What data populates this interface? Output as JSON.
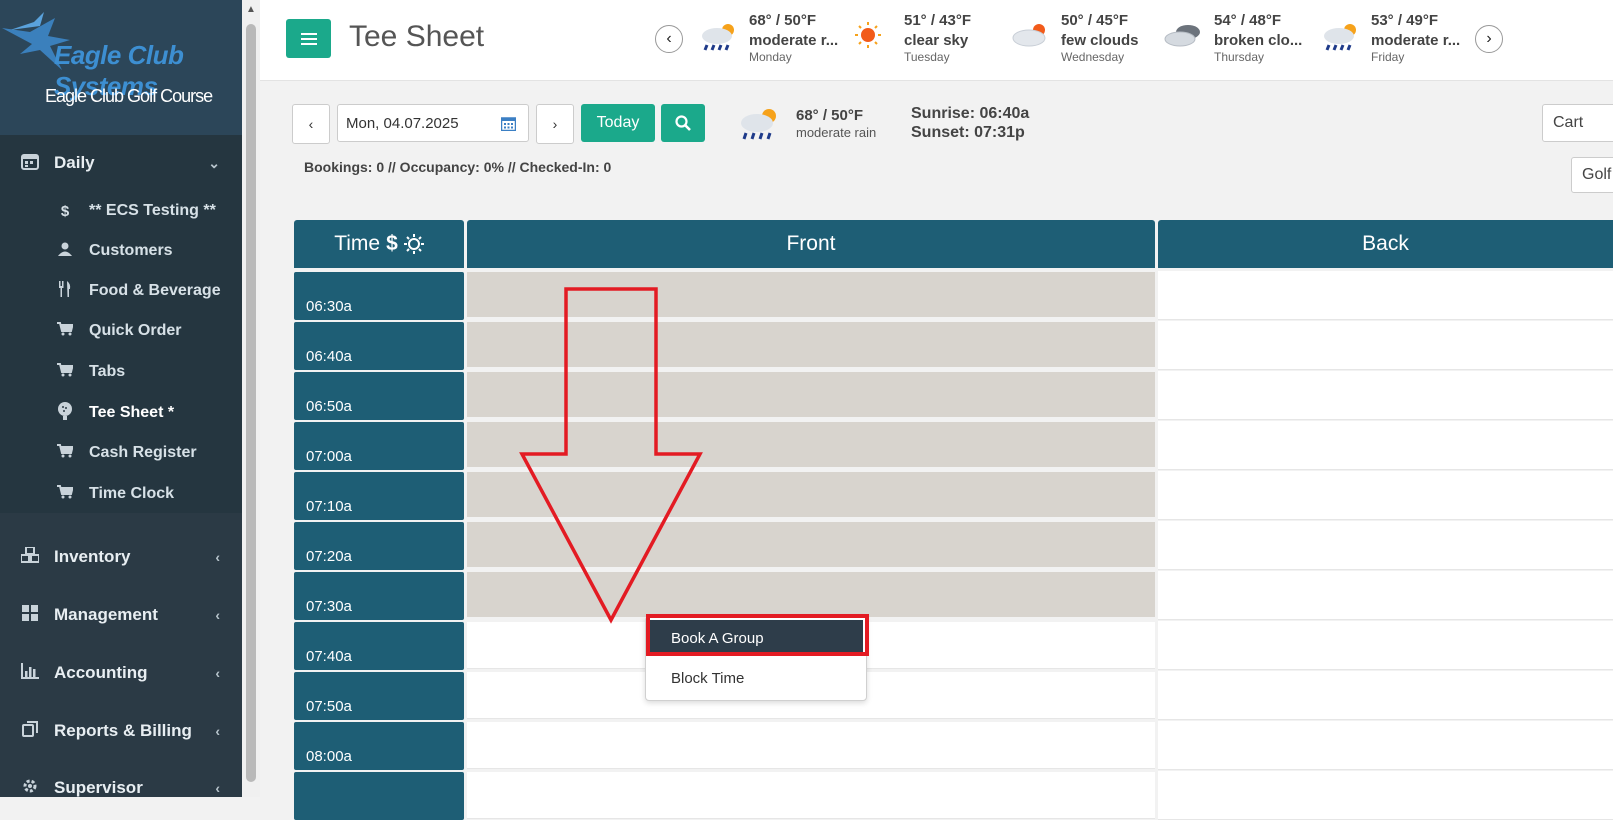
{
  "brand": {
    "name": "Eagle Club Systems",
    "course": "Eagle Club Golf Course"
  },
  "sidebar": {
    "sections": [
      {
        "label": "Daily",
        "icon": "calendar-icon"
      },
      {
        "label": "Inventory",
        "icon": "cubes-icon"
      },
      {
        "label": "Management",
        "icon": "grid-icon"
      },
      {
        "label": "Accounting",
        "icon": "bar-chart-icon"
      },
      {
        "label": "Reports & Billing",
        "icon": "copy-icon"
      },
      {
        "label": "Supervisor",
        "icon": "gear-icon"
      }
    ],
    "daily_items": [
      {
        "label": "** ECS Testing **",
        "icon": "dollar-icon"
      },
      {
        "label": "Customers",
        "icon": "user-icon"
      },
      {
        "label": "Food & Beverage",
        "icon": "utensils-icon"
      },
      {
        "label": "Quick Order",
        "icon": "cart-icon"
      },
      {
        "label": "Tabs",
        "icon": "cart-icon"
      },
      {
        "label": "Tee Sheet *",
        "icon": "golf-ball-icon",
        "active": true
      },
      {
        "label": "Cash Register",
        "icon": "cart-icon"
      },
      {
        "label": "Time Clock",
        "icon": "cart-icon"
      }
    ]
  },
  "header": {
    "title": "Tee Sheet",
    "forecast": [
      {
        "temp": "68° / 50°F",
        "desc": "moderate r...",
        "day": "Monday",
        "icon": "rain-sun-icon"
      },
      {
        "temp": "51° / 43°F",
        "desc": "clear sky",
        "day": "Tuesday",
        "icon": "sun-icon"
      },
      {
        "temp": "50° / 45°F",
        "desc": "few clouds",
        "day": "Wednesday",
        "icon": "cloud-sun-icon"
      },
      {
        "temp": "54° / 48°F",
        "desc": "broken clo...",
        "day": "Thursday",
        "icon": "broken-clouds-icon"
      },
      {
        "temp": "53° / 49°F",
        "desc": "moderate r...",
        "day": "Friday",
        "icon": "rain-sun-icon"
      }
    ]
  },
  "toolbar": {
    "date": "Mon, 04.07.2025",
    "today_label": "Today",
    "current_weather": {
      "temp": "68° / 50°F",
      "desc": "moderate rain"
    },
    "sunrise": "Sunrise: 06:40a",
    "sunset": "Sunset: 07:31p",
    "stats": "Bookings: 0 // Occupancy: 0% // Checked-In: 0",
    "cart_select": "Cart",
    "golf_select": "Golf"
  },
  "grid": {
    "headers": {
      "time": "Time",
      "front": "Front",
      "back": "Back"
    },
    "times": [
      "06:30a",
      "06:40a",
      "06:50a",
      "07:00a",
      "07:10a",
      "07:20a",
      "07:30a",
      "07:40a",
      "07:50a",
      "08:00a",
      ""
    ],
    "blocked_rows": 7
  },
  "context_menu": {
    "items": [
      "Book A Group",
      "Block Time"
    ]
  },
  "colors": {
    "accent": "#1ba98b",
    "header_teal": "#1e5e75",
    "sidebar": "#2b3a45",
    "annotation_red": "#e31b23",
    "blocked": "#d8d4ce"
  }
}
